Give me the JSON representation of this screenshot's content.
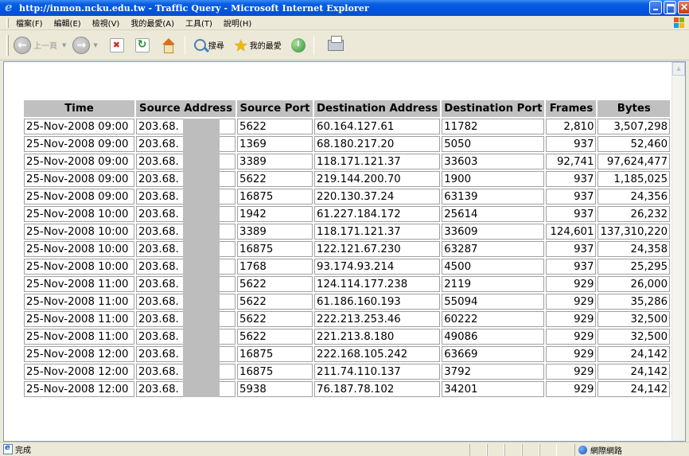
{
  "window": {
    "title": "http://inmon.ncku.edu.tw - Traffic Query - Microsoft Internet Explorer"
  },
  "menu": [
    "檔案(F)",
    "編輯(E)",
    "檢視(V)",
    "我的最愛(A)",
    "工具(T)",
    "說明(H)"
  ],
  "toolbar": {
    "back_label": "上一頁",
    "search_label": "搜尋",
    "favorites_label": "我的最愛"
  },
  "colors": {
    "titlebar": "#0054e3",
    "header_bg": "#c0c0c0",
    "redaction": "#bdbdbd"
  },
  "table": {
    "headers": [
      "Time",
      "Source Address",
      "Source Port",
      "Destination Address",
      "Destination Port",
      "Frames",
      "Bytes"
    ],
    "rows": [
      [
        "25-Nov-2008 09:00",
        "203.68.",
        "5622",
        "60.164.127.61",
        "11782",
        "2,810",
        "3,507,298"
      ],
      [
        "25-Nov-2008 09:00",
        "203.68.",
        "1369",
        "68.180.217.20",
        "5050",
        "937",
        "52,460"
      ],
      [
        "25-Nov-2008 09:00",
        "203.68.",
        "3389",
        "118.171.121.37",
        "33603",
        "92,741",
        "97,624,477"
      ],
      [
        "25-Nov-2008 09:00",
        "203.68.",
        "5622",
        "219.144.200.70",
        "1900",
        "937",
        "1,185,025"
      ],
      [
        "25-Nov-2008 09:00",
        "203.68.",
        "16875",
        "220.130.37.24",
        "63139",
        "937",
        "24,356"
      ],
      [
        "25-Nov-2008 10:00",
        "203.68.",
        "1942",
        "61.227.184.172",
        "25614",
        "937",
        "26,232"
      ],
      [
        "25-Nov-2008 10:00",
        "203.68.",
        "3389",
        "118.171.121.37",
        "33609",
        "124,601",
        "137,310,220"
      ],
      [
        "25-Nov-2008 10:00",
        "203.68.",
        "16875",
        "122.121.67.230",
        "63287",
        "937",
        "24,358"
      ],
      [
        "25-Nov-2008 10:00",
        "203.68.",
        "1768",
        "93.174.93.214",
        "4500",
        "937",
        "25,295"
      ],
      [
        "25-Nov-2008 11:00",
        "203.68.",
        "5622",
        "124.114.177.238",
        "2119",
        "929",
        "26,000"
      ],
      [
        "25-Nov-2008 11:00",
        "203.68.",
        "5622",
        "61.186.160.193",
        "55094",
        "929",
        "35,286"
      ],
      [
        "25-Nov-2008 11:00",
        "203.68.",
        "5622",
        "222.213.253.46",
        "60222",
        "929",
        "32,500"
      ],
      [
        "25-Nov-2008 11:00",
        "203.68.",
        "5622",
        "221.213.8.180",
        "49086",
        "929",
        "32,500"
      ],
      [
        "25-Nov-2008 12:00",
        "203.68.",
        "16875",
        "222.168.105.242",
        "63669",
        "929",
        "24,142"
      ],
      [
        "25-Nov-2008 12:00",
        "203.68.",
        "16875",
        "211.74.110.137",
        "3792",
        "929",
        "24,142"
      ],
      [
        "25-Nov-2008 12:00",
        "203.68.",
        "5938",
        "76.187.78.102",
        "34201",
        "929",
        "24,142"
      ]
    ]
  },
  "status": {
    "text": "完成",
    "zone": "網際網路"
  }
}
